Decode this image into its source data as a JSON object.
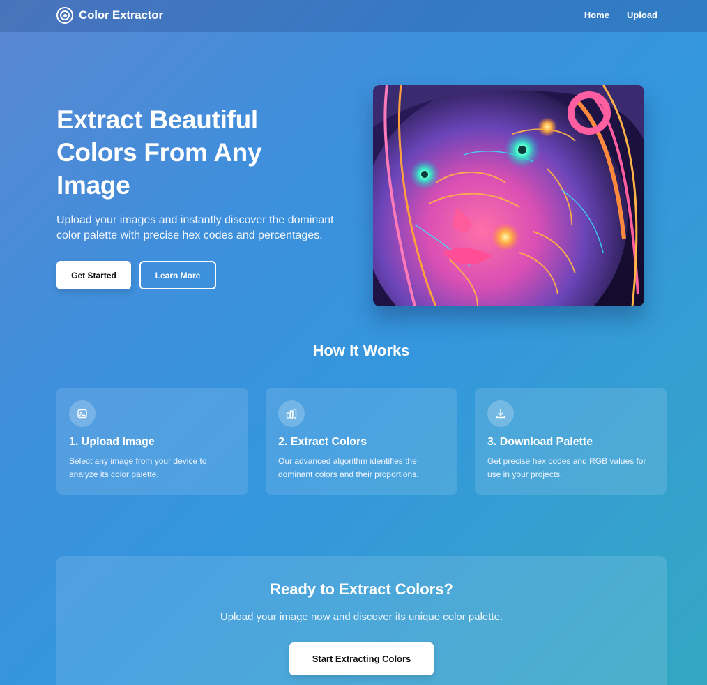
{
  "nav": {
    "brand": "Color Extractor",
    "brand_icon": "target-icon",
    "links": [
      "Home",
      "Upload"
    ]
  },
  "hero": {
    "title": "Extract Beautiful Colors From Any Image",
    "subtitle": "Upload your images and instantly discover the dominant color palette with precise hex codes and percentages.",
    "primary_button": "Get Started",
    "secondary_button": "Learn More",
    "image_alt": ""
  },
  "how_it_works": {
    "title": "How It Works",
    "steps": [
      {
        "icon": "image-icon",
        "title": "1. Upload Image",
        "description": "Select any image from your device to analyze its color palette."
      },
      {
        "icon": "bar-chart-icon",
        "title": "2. Extract Colors",
        "description": "Our advanced algorithm identifies the dominant colors and their proportions."
      },
      {
        "icon": "download-icon",
        "title": "3. Download Palette",
        "description": "Get precise hex codes and RGB values for use in your projects."
      }
    ]
  },
  "cta": {
    "title": "Ready to Extract Colors?",
    "subtitle": "Upload your image now and discover its unique color palette.",
    "button": "Start Extracting Colors"
  },
  "colors": {
    "gradient_start": "#5b86d1",
    "gradient_mid": "#3496dd",
    "gradient_end": "#33a7c2",
    "button_bg": "#ffffff",
    "button_text": "#111111"
  }
}
